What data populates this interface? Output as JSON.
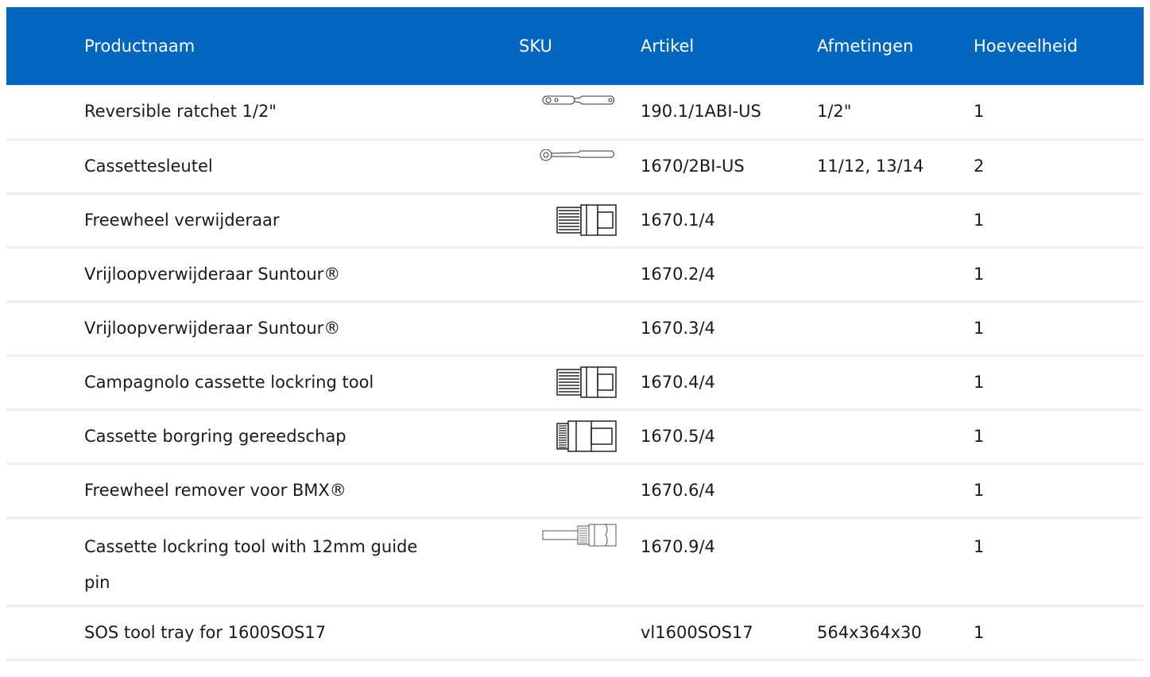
{
  "header": {
    "col_name": "Productnaam",
    "col_sku": "SKU",
    "col_article": "Artikel",
    "col_dimensions": "Afmetingen",
    "col_quantity": "Hoeveelheid"
  },
  "colors": {
    "header_bg": "#0066bf",
    "header_text": "#ffffff",
    "row_divider": "#efefef"
  },
  "rows": [
    {
      "name": "Reversible ratchet 1/2\"",
      "image": "ratchet-icon",
      "article": "190.1/1ABI-US",
      "dimensions": "1/2\"",
      "quantity": "1"
    },
    {
      "name": "Cassettesleutel",
      "image": "ratchet-icon",
      "article": "1670/2BI-US",
      "dimensions": "11/12, 13/14",
      "quantity": "2"
    },
    {
      "name": "Freewheel verwijderaar",
      "image": "socket-tool-icon",
      "article": "1670.1/4",
      "dimensions": "",
      "quantity": "1"
    },
    {
      "name": "Vrijloopverwijderaar Suntour®",
      "image": "",
      "article": "1670.2/4",
      "dimensions": "",
      "quantity": "1"
    },
    {
      "name": "Vrijloopverwijderaar Suntour®",
      "image": "",
      "article": "1670.3/4",
      "dimensions": "",
      "quantity": "1"
    },
    {
      "name": "Campagnolo cassette lockring tool",
      "image": "socket-tool-icon",
      "article": "1670.4/4",
      "dimensions": "",
      "quantity": "1"
    },
    {
      "name": "Cassette borgring gereedschap",
      "image": "socket-tool-icon",
      "article": "1670.5/4",
      "dimensions": "",
      "quantity": "1"
    },
    {
      "name": "Freewheel remover voor BMX®",
      "image": "",
      "article": "1670.6/4",
      "dimensions": "",
      "quantity": "1"
    },
    {
      "name": "Cassette lockring tool with 12mm guide pin",
      "image": "guide-pin-tool-icon",
      "article": "1670.9/4",
      "dimensions": "",
      "quantity": "1"
    },
    {
      "name": "SOS tool tray for 1600SOS17",
      "image": "",
      "article": "vl1600SOS17",
      "dimensions": "564x364x30",
      "quantity": "1"
    }
  ]
}
